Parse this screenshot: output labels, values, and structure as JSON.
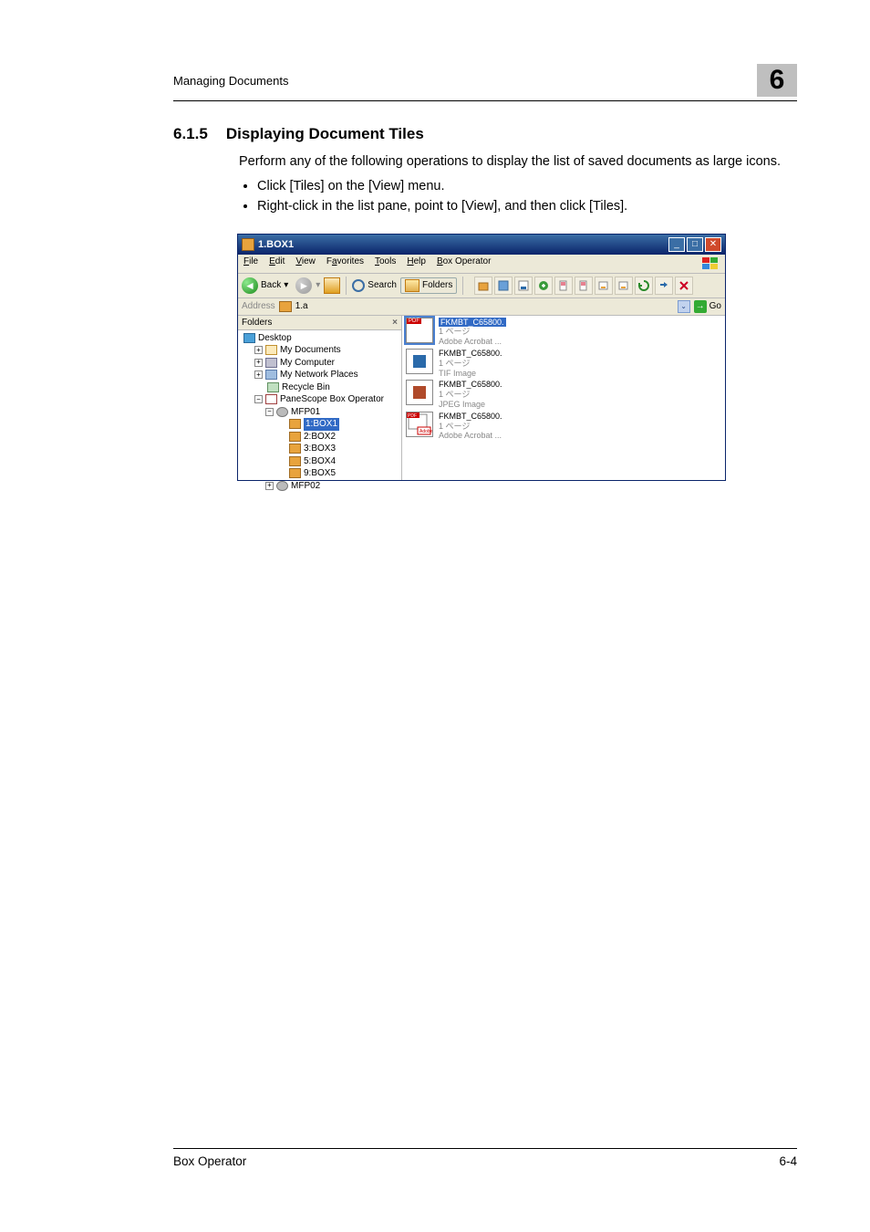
{
  "header": {
    "breadcrumb": "Managing Documents",
    "chapter": "6"
  },
  "section": {
    "number": "6.1.5",
    "title": "Displaying Document Tiles",
    "intro": "Perform any of the following operations to display the list of saved documents as large icons.",
    "bullets": [
      "Click [Tiles] on the [View] menu.",
      "Right-click in the list pane, point to [View], and then click [Tiles]."
    ]
  },
  "window": {
    "title": "1.BOX1",
    "menus": {
      "file": "File",
      "edit": "Edit",
      "view": "View",
      "favorites": "Favorites",
      "tools": "Tools",
      "help": "Help",
      "box": "Box Operator"
    },
    "toolbar": {
      "back": "Back",
      "search": "Search",
      "folders": "Folders"
    },
    "address": {
      "label": "Address",
      "value": "1.a",
      "go": "Go"
    },
    "tree": {
      "header": "Folders",
      "nodes": {
        "desktop": "Desktop",
        "mydocs": "My Documents",
        "mycomp": "My Computer",
        "mynet": "My Network Places",
        "recycle": "Recycle Bin",
        "scope": "PaneScope Box Operator",
        "mfp01": "MFP01",
        "box1": "1:BOX1",
        "box2": "2:BOX2",
        "box3": "3:BOX3",
        "box4": "5:BOX4",
        "box5": "9:BOX5",
        "mfp02": "MFP02"
      }
    },
    "tiles": [
      {
        "name": "FKMBT_C65800.",
        "pages": "1 ページ",
        "type": "Adobe Acrobat ...",
        "kind": "pdf",
        "selected": true
      },
      {
        "name": "FKMBT_C65800.",
        "pages": "1 ページ",
        "type": "TIF Image",
        "kind": "tif",
        "selected": false
      },
      {
        "name": "FKMBT_C65800.",
        "pages": "1 ページ",
        "type": "JPEG Image",
        "kind": "jpg",
        "selected": false
      },
      {
        "name": "FKMBT_C65800.",
        "pages": "1 ページ",
        "type": "Adobe Acrobat ...",
        "kind": "mini",
        "selected": false
      }
    ]
  },
  "footer": {
    "product": "Box Operator",
    "page": "6-4"
  }
}
